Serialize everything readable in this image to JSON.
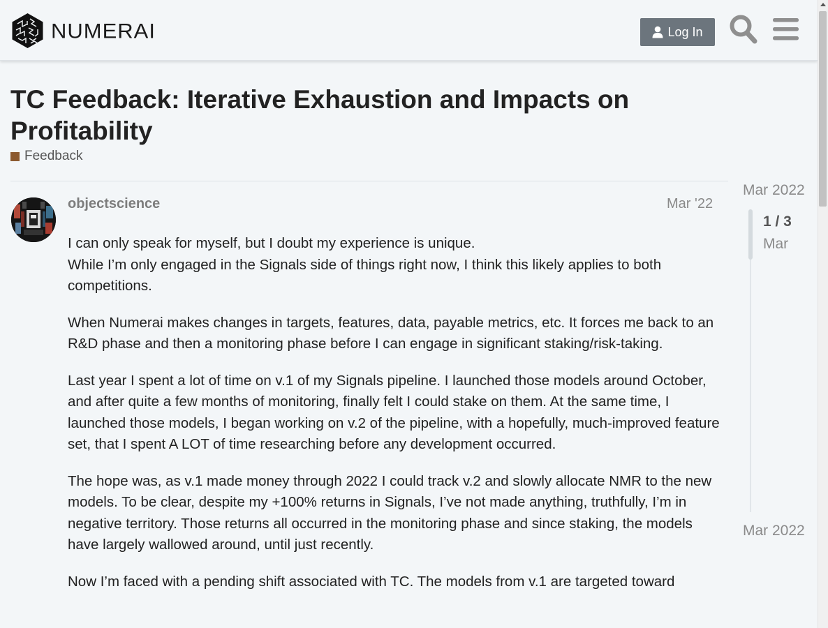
{
  "header": {
    "logo_text": "NUMERAI",
    "login_label": "Log In",
    "icons": [
      "cube-logo-icon",
      "user-icon",
      "search-icon",
      "hamburger-menu-icon"
    ]
  },
  "topic": {
    "title": "TC Feedback: Iterative Exhaustion and Impacts on Profitability",
    "category": "Feedback",
    "category_color": "#8c5a2f"
  },
  "post": {
    "username": "objectscience",
    "date": "Mar '22",
    "paragraphs": [
      "I can only speak for myself, but I doubt my experience is unique.\nWhile I’m only engaged in the Signals side of things right now, I think this likely applies to both competitions.",
      "When Numerai makes changes in targets, features, data, payable metrics, etc. It forces me back to an R&D phase and then a monitoring phase before I can engage in significant staking/risk-taking.",
      "Last year I spent a lot of time on v.1 of my Signals pipeline. I launched those models around October, and after quite a few months of monitoring, finally felt I could stake on them. At the same time, I launched those models, I began working on v.2 of the pipeline, with a hopefully, much-improved feature set, that I spent A LOT of time researching before any development occurred.",
      "The hope was, as v.1 made money through 2022 I could track v.2 and slowly allocate NMR to the new models. To be clear, despite my +100% returns in Signals, I’ve not made anything, truthfully, I’m in negative territory. Those returns all occurred in the monitoring phase and since staking, the models have largely wallowed around, until just recently.",
      "Now I’m faced with a pending shift associated with TC. The models from v.1 are targeted toward"
    ]
  },
  "timeline": {
    "start": "Mar 2022",
    "position": "1 / 3",
    "current_date": "Mar",
    "end": "Mar 2022"
  },
  "colors": {
    "background": "#f3f6f8",
    "login_button": "#6c757d",
    "muted_text": "#8a8a8a"
  }
}
